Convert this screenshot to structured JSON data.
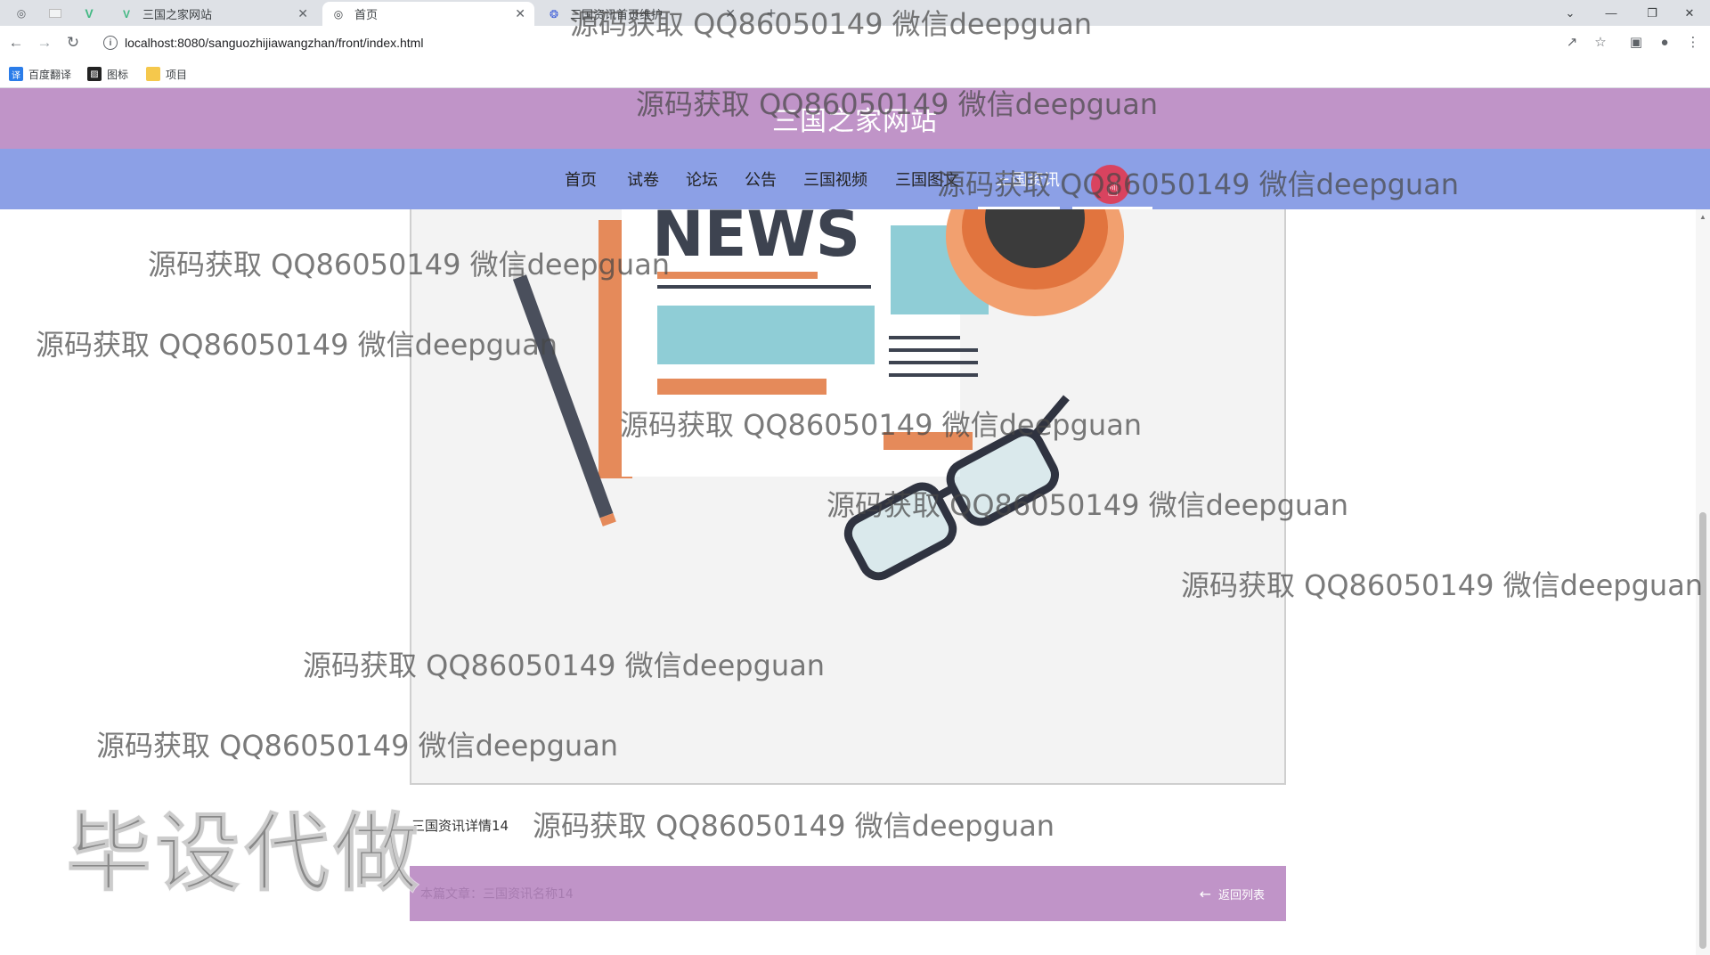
{
  "browser": {
    "tabs": [
      {
        "label": "三国之家网站",
        "icon": "vue-icon",
        "active": false
      },
      {
        "label": "首页",
        "icon": "globe-icon",
        "active": true
      },
      {
        "label": "三国资讯首页维护",
        "icon": "baidu-icon",
        "active": false
      }
    ],
    "url": "localhost:8080/sanguozhijiawangzhan/front/index.html",
    "bookmarks": [
      {
        "label": "百度翻译",
        "icon": "translate-icon"
      },
      {
        "label": "图标",
        "icon": "image-icon"
      },
      {
        "label": "项目",
        "icon": "folder-icon"
      }
    ]
  },
  "site": {
    "title": "三国之家网站",
    "nav": [
      {
        "label": "首页",
        "active": false
      },
      {
        "label": "试卷",
        "active": false
      },
      {
        "label": "论坛",
        "active": false
      },
      {
        "label": "公告",
        "active": false
      },
      {
        "label": "三国视频",
        "active": false
      },
      {
        "label": "三国图文",
        "active": false
      },
      {
        "label": "三国资讯",
        "active": true
      }
    ]
  },
  "article": {
    "image_text": "NEWS",
    "title": "三国资讯详情14",
    "current_label": "本篇文章：三国资讯名称14",
    "back_label": "返回列表"
  },
  "watermarks": {
    "text": "源码获取 QQ86050149 微信deepguan",
    "stamp": "毕设代做"
  },
  "colors": {
    "header": "#c094c8",
    "nav": "#8ca0e6",
    "active_nav": "#ffffff"
  }
}
